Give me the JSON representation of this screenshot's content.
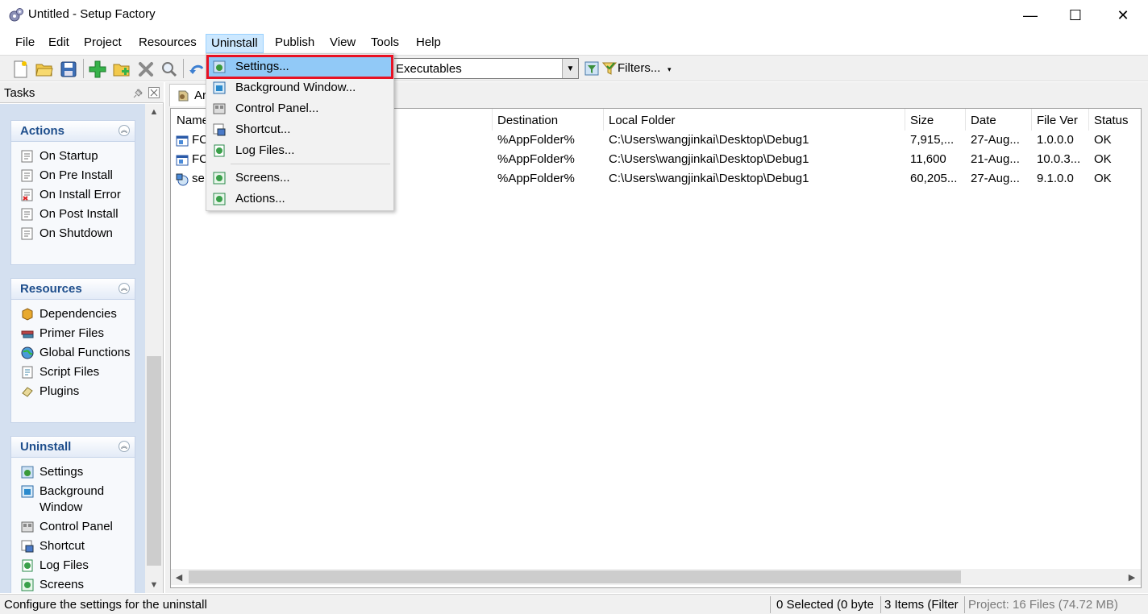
{
  "window": {
    "title": "Untitled - Setup Factory",
    "minimize": "—",
    "maximize": "☐",
    "close": "✕"
  },
  "menu": {
    "items": [
      "File",
      "Edit",
      "Project",
      "Resources",
      "Uninstall",
      "Publish",
      "View",
      "Tools",
      "Help"
    ],
    "active": "Uninstall"
  },
  "toolbar": {
    "filter_value": "Executables",
    "filters_label": "Filters...",
    "filters_arrow": "▾"
  },
  "tasks": {
    "title": "Tasks",
    "groups": [
      {
        "title": "Actions",
        "items": [
          "On Startup",
          "On Pre Install",
          "On Install Error",
          "On Post Install",
          "On Shutdown"
        ]
      },
      {
        "title": "Resources",
        "items": [
          "Dependencies",
          "Primer Files",
          "Global Functions",
          "Script Files",
          "Plugins"
        ]
      },
      {
        "title": "Uninstall",
        "items": [
          "Settings",
          "Background Window",
          "Control Panel",
          "Shortcut",
          "Log Files",
          "Screens"
        ]
      }
    ]
  },
  "tab": {
    "label": "Ar"
  },
  "filelist": {
    "columns": [
      "Name",
      "Destination",
      "Local Folder",
      "Size",
      "Date",
      "File Ver",
      "Status"
    ],
    "rows": [
      {
        "name": "FC",
        "destination": "%AppFolder%",
        "local_folder": "C:\\Users\\wangjinkai\\Desktop\\Debug1",
        "size": "7,915,...",
        "date": "27-Aug...",
        "file_ver": "1.0.0.0",
        "status": "OK"
      },
      {
        "name": "FC",
        "destination": "%AppFolder%",
        "local_folder": "C:\\Users\\wangjinkai\\Desktop\\Debug1",
        "size": "11,600",
        "date": "21-Aug...",
        "file_ver": "10.0.3...",
        "status": "OK"
      },
      {
        "name": "se",
        "destination": "%AppFolder%",
        "local_folder": "C:\\Users\\wangjinkai\\Desktop\\Debug1",
        "size": "60,205...",
        "date": "27-Aug...",
        "file_ver": "9.1.0.0",
        "status": "OK"
      }
    ]
  },
  "uninstall_menu": {
    "items": [
      {
        "label": "Settings...",
        "highlighted": true
      },
      {
        "label": "Background Window..."
      },
      {
        "label": "Control Panel..."
      },
      {
        "label": "Shortcut..."
      },
      {
        "label": "Log Files..."
      },
      {
        "label": "Screens..."
      },
      {
        "label": "Actions..."
      }
    ]
  },
  "status": {
    "message": "Configure the settings for the uninstall",
    "selected": "0 Selected (0 byte",
    "items": "3 Items (Filter",
    "project": "Project: 16 Files (74.72 MB)"
  },
  "colors": {
    "highlight": "#91c9f7",
    "highlight_border": "#e81123",
    "group_title": "#1e4e8c"
  }
}
